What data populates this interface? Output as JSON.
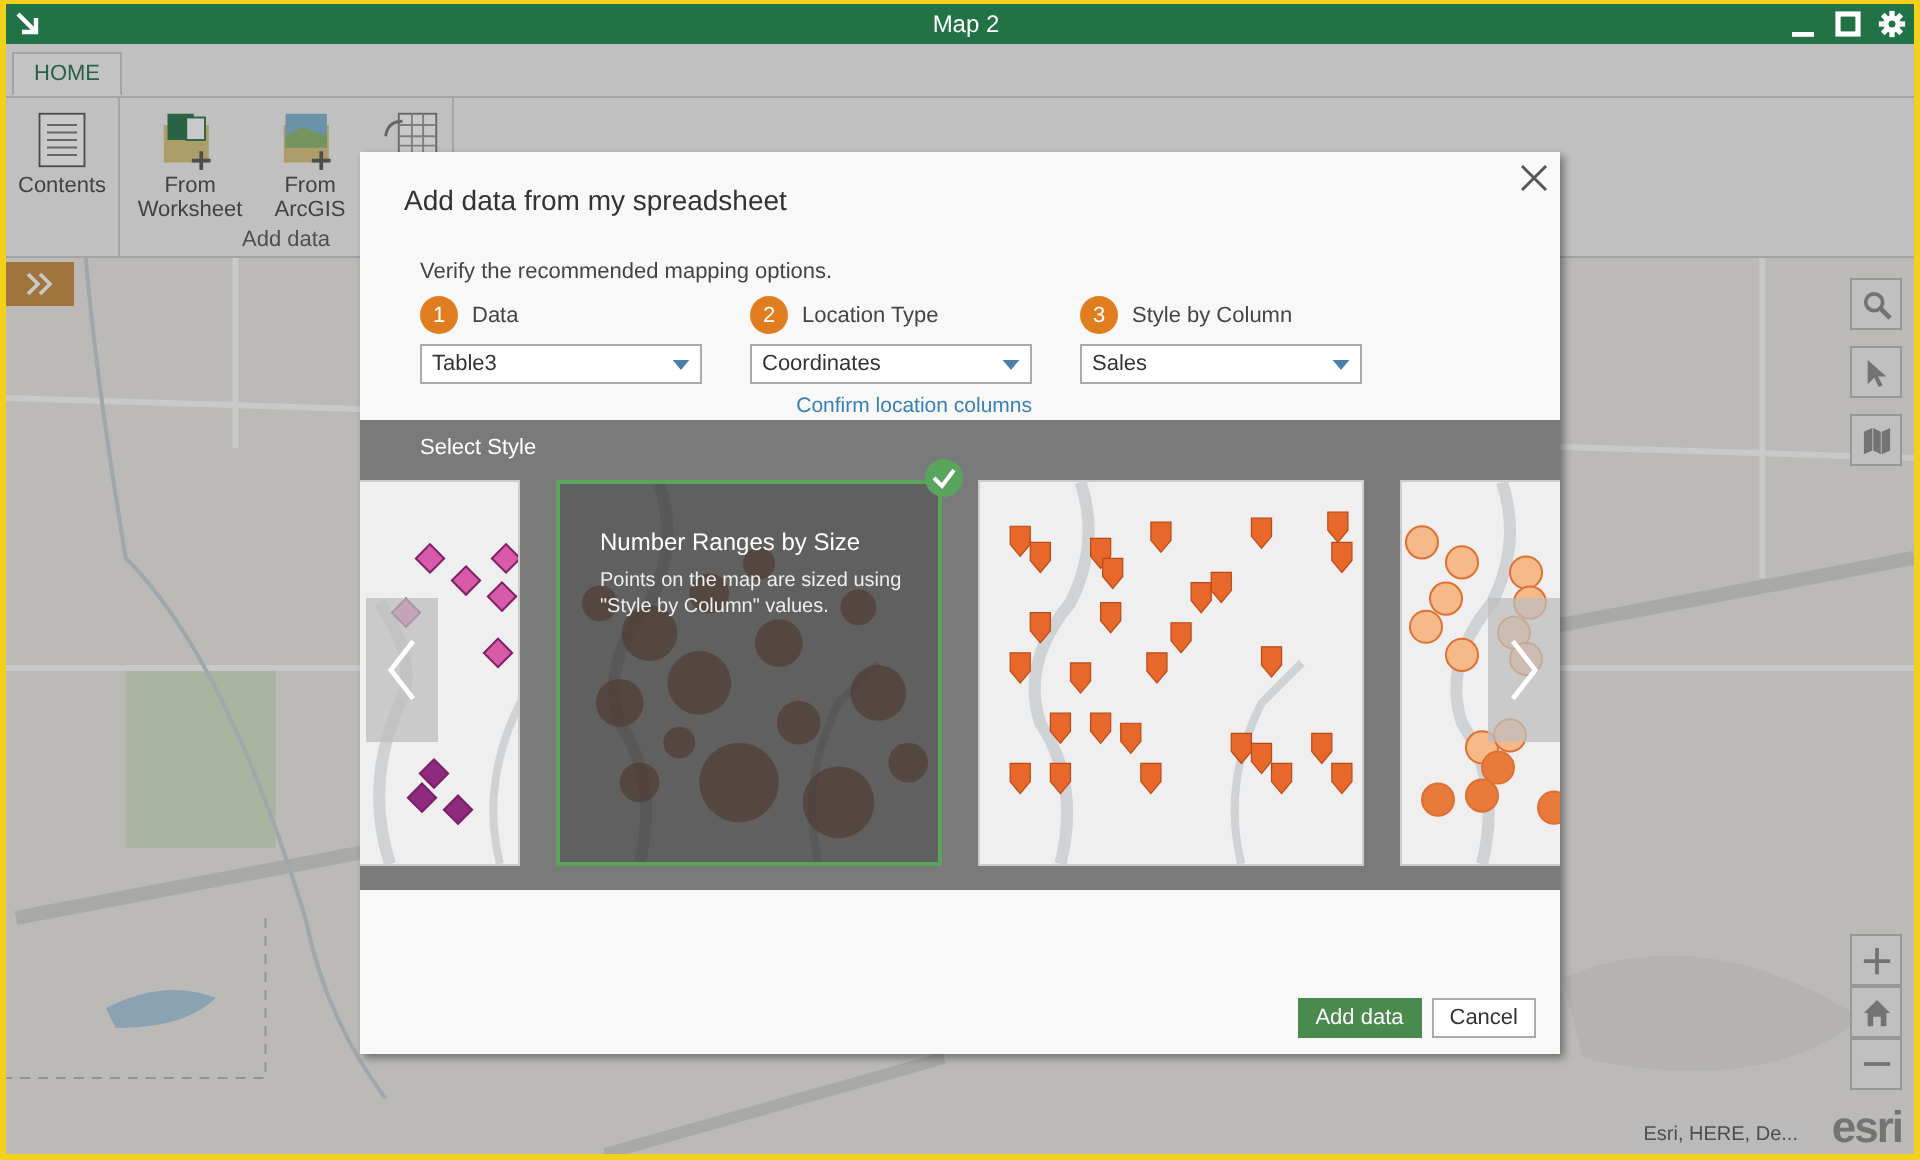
{
  "window": {
    "title": "Map 2"
  },
  "ribbon": {
    "tabs": [
      {
        "label": "HOME",
        "selected": true
      }
    ],
    "buttons": [
      {
        "label": "Contents"
      },
      {
        "label": "From Worksheet"
      },
      {
        "label": "From ArcGIS"
      }
    ],
    "group_label": "Add data"
  },
  "map": {
    "attribution": "Esri, HERE, De...",
    "logo": "esri"
  },
  "dialog": {
    "title": "Add data from my spreadsheet",
    "instruction": "Verify the recommended mapping options.",
    "steps": [
      {
        "number": "1",
        "label": "Data",
        "value": "Table3"
      },
      {
        "number": "2",
        "label": "Location Type",
        "value": "Coordinates",
        "link": "Confirm location columns"
      },
      {
        "number": "3",
        "label": "Style by Column",
        "value": "Sales"
      }
    ],
    "section_title": "Select Style",
    "styles": [
      {
        "kind": "diamonds",
        "selected": false
      },
      {
        "kind": "sized-circles",
        "selected": true,
        "title": "Number Ranges by Size",
        "description": "Points on the map are sized using \"Style by Column\" values."
      },
      {
        "kind": "pins",
        "selected": false
      },
      {
        "kind": "circles",
        "selected": false
      }
    ],
    "buttons": [
      {
        "label": "Add data",
        "kind": "primary"
      },
      {
        "label": "Cancel",
        "kind": "secondary"
      }
    ]
  }
}
